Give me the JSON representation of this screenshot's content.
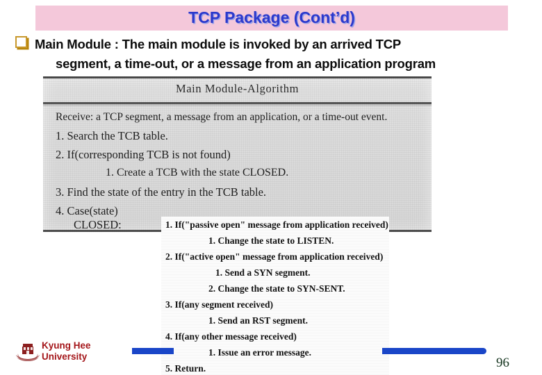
{
  "slide": {
    "title": "TCP Package (Cont’d)",
    "title_band_color": "#f4c8da",
    "title_text_color": "#2b39cc",
    "page_number": "96"
  },
  "bullets": [
    {
      "marker": "filled-square-bullet-icon",
      "line1": "Main Module : The main module is invoked by an arrived TCP",
      "line2": "segment, a time-out, or a message from an application program"
    }
  ],
  "figure": {
    "block_a": {
      "heading": "Main Module-Algorithm",
      "lines": [
        {
          "text": "Receive: a TCP segment, a message from an application, or a time-out event.",
          "indent": 0
        },
        {
          "text": "1. Search the TCB table.",
          "indent": 0
        },
        {
          "text": "2. If(corresponding TCB is not found)",
          "indent": 0
        },
        {
          "text": "1. Create a TCB with the state CLOSED.",
          "indent": 1
        },
        {
          "text": "3. Find the state of the entry in the TCB table.",
          "indent": 0
        },
        {
          "text": "4. Case(state)",
          "indent": 0
        },
        {
          "text": "CLOSED:",
          "indent": 1
        }
      ]
    },
    "block_b": {
      "lines": [
        {
          "text": "1. If(\"passive open\" message from application received)",
          "indent": 0
        },
        {
          "text": "1. Change the state to LISTEN.",
          "indent": 1
        },
        {
          "text": "2. If(\"active open\" message from application received)",
          "indent": 0
        },
        {
          "text": "1. Send a SYN segment.",
          "indent": 1
        },
        {
          "text": "2. Change the state to SYN-SENT.",
          "indent": 1
        },
        {
          "text": "3. If(any segment received)",
          "indent": 0
        },
        {
          "text": "1. Send an RST segment.",
          "indent": 1
        },
        {
          "text": "4. If(any other message received)",
          "indent": 0
        },
        {
          "text": "1. Issue an error message.",
          "indent": 1
        },
        {
          "text": "5. Return.",
          "indent": 0
        }
      ]
    }
  },
  "footer": {
    "logo_line1": "Kyung Hee",
    "logo_line2": "University",
    "logo_color": "#a4161a",
    "bar_color": "#1a46c8"
  }
}
